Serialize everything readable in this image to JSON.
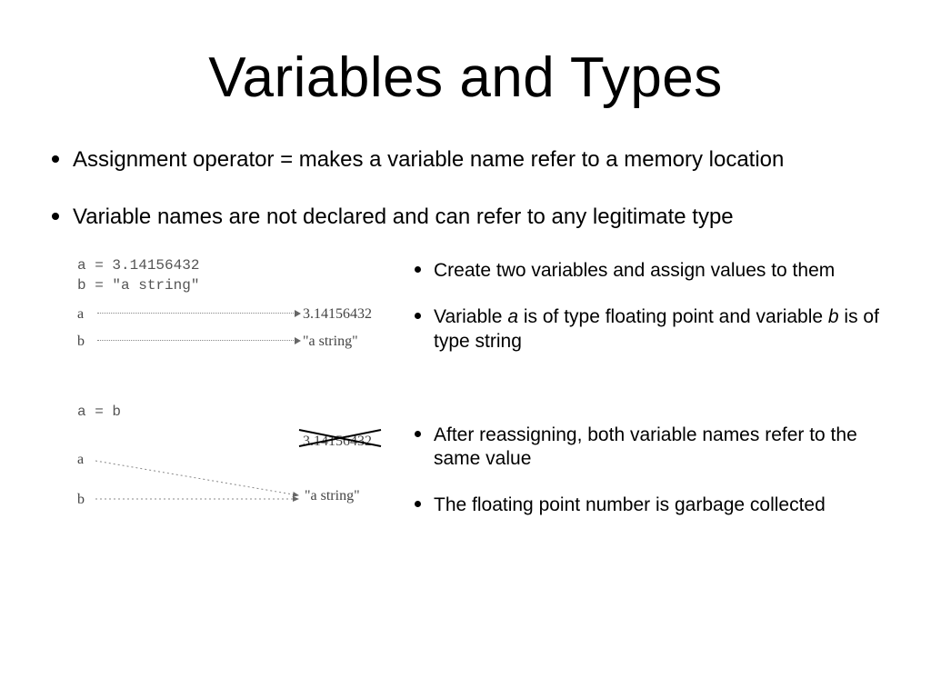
{
  "title": "Variables and Types",
  "bullets": {
    "b1": "Assignment operator  =  makes a variable name refer to a memory location",
    "b2": "Variable names are not declared and can refer to any legitimate type"
  },
  "diagram1": {
    "code_line1": "a = 3.14156432",
    "code_line2": "b = \"a string\"",
    "a_label": "a",
    "a_value": "3.14156432",
    "b_label": "b",
    "b_value": "\"a string\""
  },
  "diagram2": {
    "code_line1": "a = b",
    "a_label": "a",
    "a_old_value": "3.14156432",
    "b_label": "b",
    "b_value": "\"a string\""
  },
  "notes": {
    "n1": "Create two variables and assign values to them",
    "n2_pre": "Variable ",
    "n2_a": "a",
    "n2_mid": " is of type floating point and variable ",
    "n2_b": "b",
    "n2_post": " is of type string",
    "n3": "After reassigning, both variable names refer to the same value",
    "n4": "The floating point number is garbage collected"
  }
}
